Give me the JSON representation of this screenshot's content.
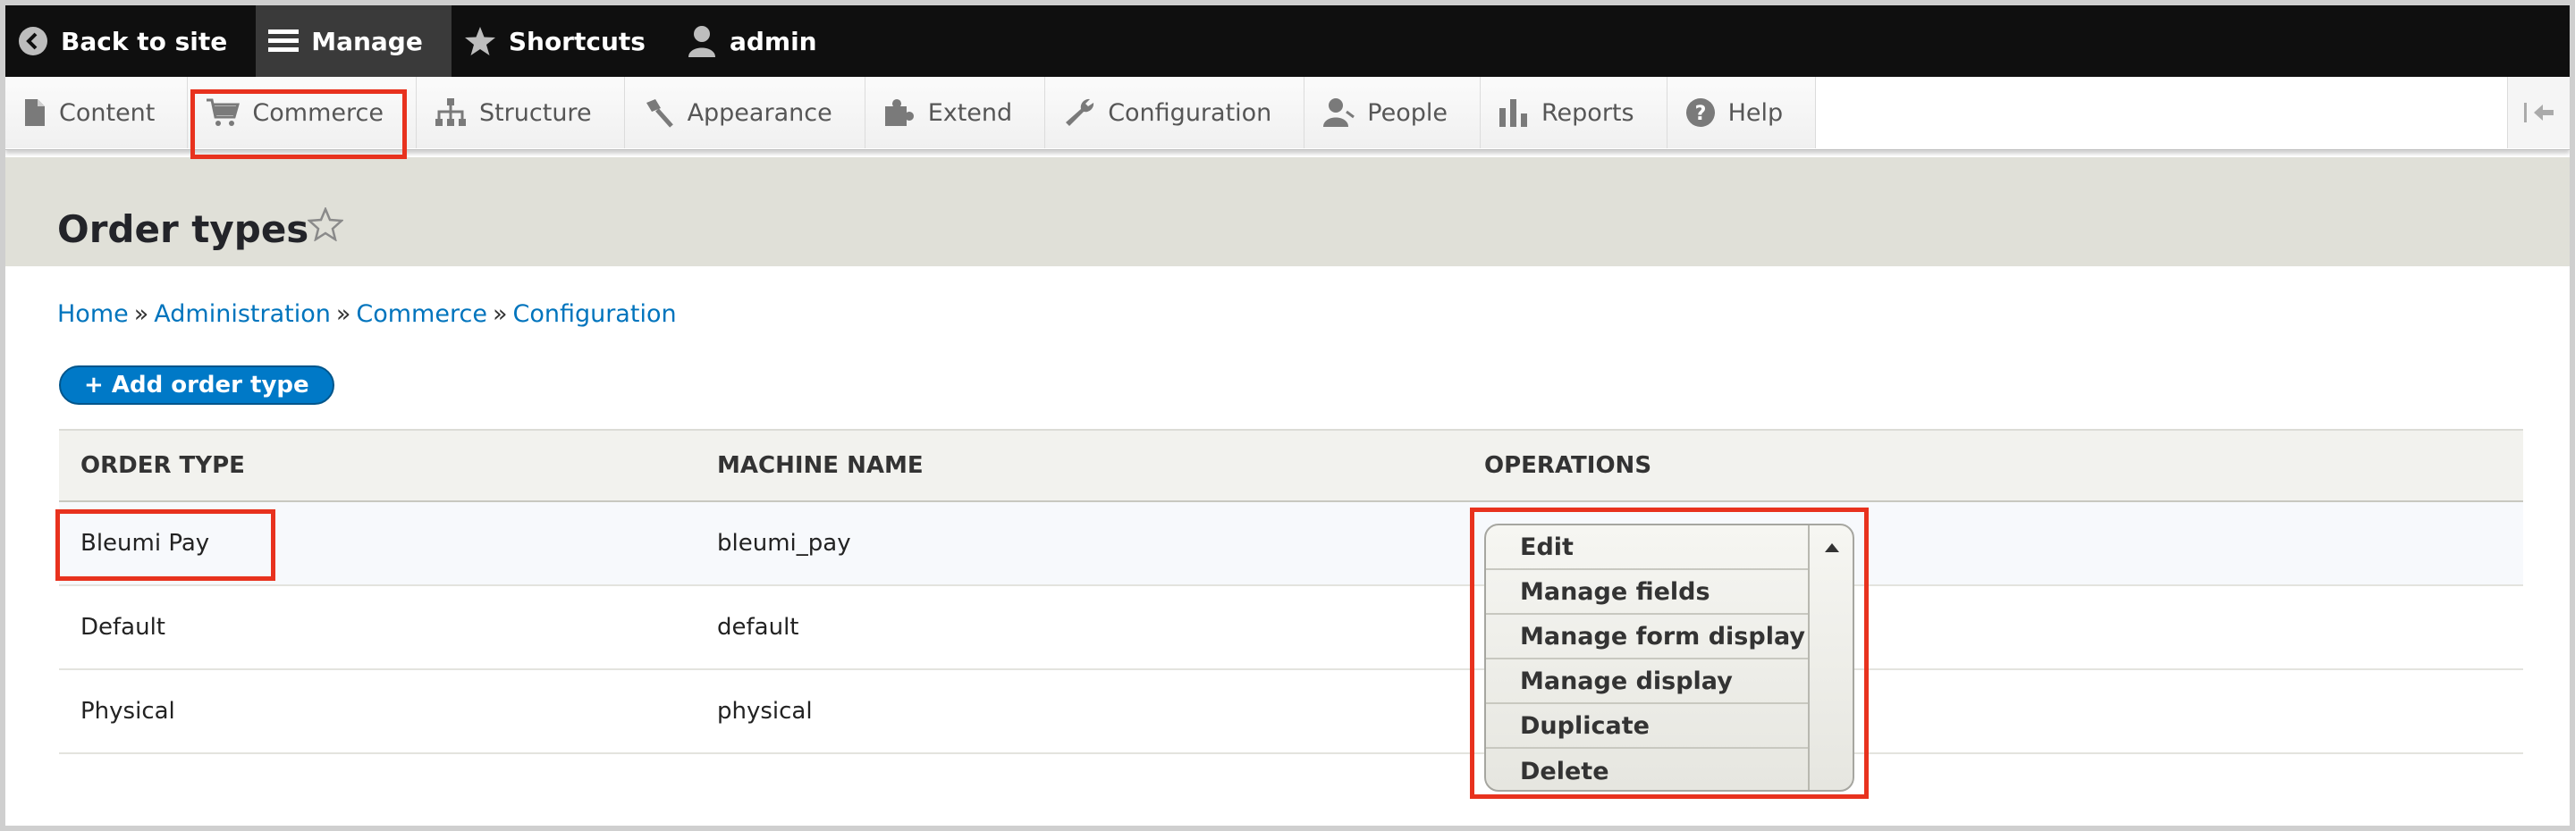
{
  "toolbar": {
    "back_label": "Back to site",
    "manage_label": "Manage",
    "shortcuts_label": "Shortcuts",
    "user_label": "admin"
  },
  "tray": {
    "items": [
      {
        "label": "Content",
        "icon": "file-icon"
      },
      {
        "label": "Commerce",
        "icon": "cart-icon"
      },
      {
        "label": "Structure",
        "icon": "sitemap-icon"
      },
      {
        "label": "Appearance",
        "icon": "brush-icon"
      },
      {
        "label": "Extend",
        "icon": "puzzle-icon"
      },
      {
        "label": "Configuration",
        "icon": "wrench-icon"
      },
      {
        "label": "People",
        "icon": "person-icon"
      },
      {
        "label": "Reports",
        "icon": "bar-chart-icon"
      },
      {
        "label": "Help",
        "icon": "help-icon"
      }
    ]
  },
  "page": {
    "title": "Order types"
  },
  "breadcrumb": {
    "items": [
      "Home",
      "Administration",
      "Commerce",
      "Configuration"
    ],
    "separator": "»"
  },
  "add_button": {
    "label": "+ Add order type"
  },
  "table": {
    "headers": [
      "ORDER TYPE",
      "MACHINE NAME",
      "OPERATIONS"
    ],
    "rows": [
      {
        "order_type": "Bleumi Pay",
        "machine_name": "bleumi_pay"
      },
      {
        "order_type": "Default",
        "machine_name": "default"
      },
      {
        "order_type": "Physical",
        "machine_name": "physical"
      }
    ]
  },
  "operations": {
    "items": [
      "Edit",
      "Manage fields",
      "Manage form display",
      "Manage display",
      "Duplicate",
      "Delete"
    ]
  },
  "colors": {
    "highlight": "#e8321e",
    "link": "#0074bd",
    "button": "#0079c7"
  }
}
